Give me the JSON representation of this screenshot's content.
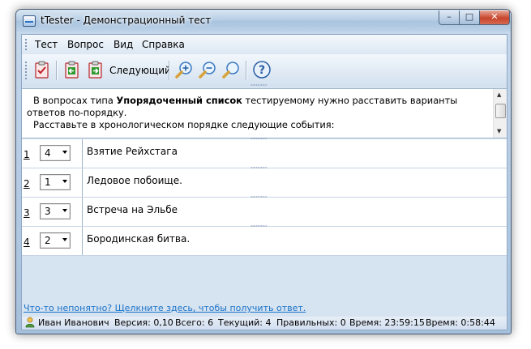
{
  "window": {
    "title": "tTester - Демонстрационный тест",
    "controls": {
      "minimize": "–",
      "maximize": "□",
      "close": "✕"
    }
  },
  "menu": [
    "Тест",
    "Вопрос",
    "Вид",
    "Справка"
  ],
  "toolbar": {
    "buttons": [
      {
        "icon": "test-checklist-icon"
      },
      {
        "icon": "previous-question-icon"
      },
      {
        "icon": "next-question-icon"
      },
      {
        "icon": "zoom-in-icon"
      },
      {
        "icon": "zoom-out-icon"
      },
      {
        "icon": "zoom-reset-icon"
      },
      {
        "icon": "help-icon"
      }
    ],
    "next_label": "Следующий"
  },
  "question": {
    "line1_prefix": "В вопросах типа ",
    "line1_bold": "Упорядоченный список",
    "line1_suffix": " тестируемому нужно расставить варианты ответов по-порядку.",
    "line2": "Расставьте в хронологическом порядке следующие события:"
  },
  "answers": [
    {
      "num": "1",
      "order": "4",
      "text": "Взятие Рейхстага"
    },
    {
      "num": "2",
      "order": "1",
      "text": "Ледовое побоище."
    },
    {
      "num": "3",
      "order": "3",
      "text": "Встреча на Эльбе"
    },
    {
      "num": "4",
      "order": "2",
      "text": "Бородинская битва."
    }
  ],
  "help_link": "Что-то непонятно? Щелкните здесь, чтобы получить ответ.",
  "status": {
    "user": "Иван Иванович",
    "version": "Версия: 0,10",
    "total": "Всего: 6",
    "current": "Текущий: 4",
    "correct": "Правильных: 0",
    "time": "Время: 23:59:15",
    "elapsed": "Время: 0:58:44"
  },
  "colors": {
    "link": "#1a73c8",
    "window_frame": "#a6c0dc",
    "close_button": "#c7452c"
  }
}
